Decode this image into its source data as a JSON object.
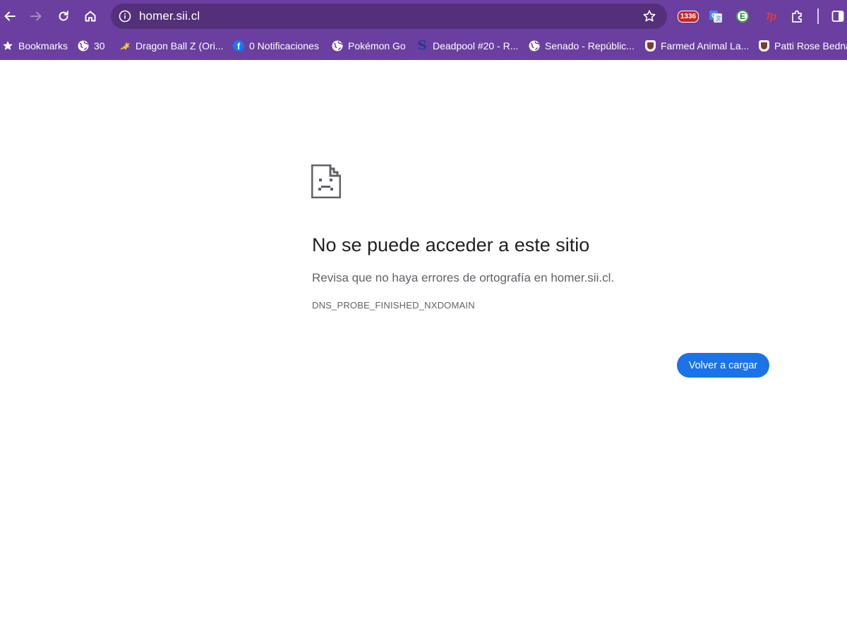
{
  "browser": {
    "url": "homer.sii.cl",
    "extensions": {
      "badge_count": "1336",
      "green_circle_letter": "E",
      "tp_label": "Tp"
    }
  },
  "bookmarks": [
    {
      "label": "Bookmarks",
      "icon": "star-icon"
    },
    {
      "label": "30",
      "icon": "globe-icon"
    },
    {
      "label": "Dragon Ball Z (Ori...",
      "icon": "dragon-ball-favicon"
    },
    {
      "label": "0 Notificaciones",
      "icon": "facebook-icon"
    },
    {
      "label": "Pokémon Go",
      "icon": "globe-icon"
    },
    {
      "label": "Deadpool #20 - R...",
      "icon": "deadpool-favicon"
    },
    {
      "label": "Senado - Repúblic...",
      "icon": "globe-icon"
    },
    {
      "label": "Farmed Animal La...",
      "icon": "shield-favicon"
    },
    {
      "label": "Patti Rose Bedna",
      "icon": "shield-favicon"
    }
  ],
  "error": {
    "icon": "sad-page-icon",
    "title": "No se puede acceder a este sitio",
    "subtitle": "Revisa que no haya errores de ortografía en homer.sii.cl.",
    "code": "DNS_PROBE_FINISHED_NXDOMAIN",
    "reload_label": "Volver a cargar"
  },
  "colors": {
    "chrome": "#6a3fa0",
    "omnibox": "#533079",
    "button": "#1a73e8"
  }
}
